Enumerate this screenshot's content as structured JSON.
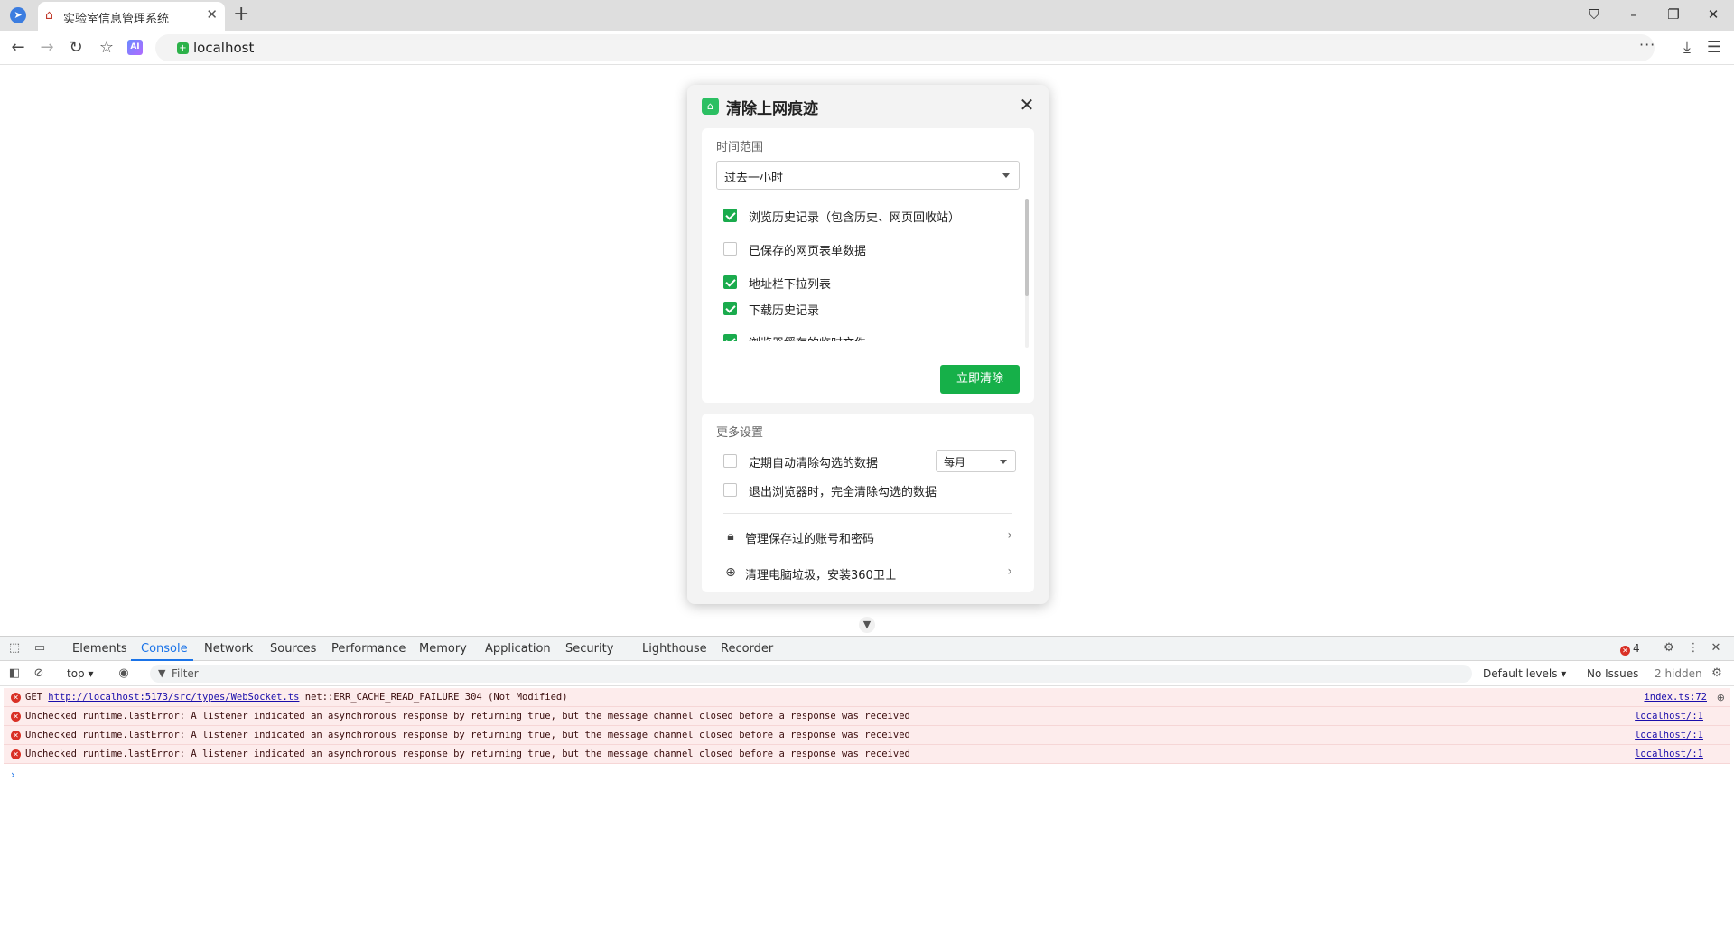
{
  "browser": {
    "tab_title": "实验室信息管理系统",
    "address": "localhost",
    "icons": {
      "browser_logo": "send-arrow-icon",
      "tab_favicon": "house-icon",
      "close": "x-icon",
      "new_tab": "plus-icon",
      "back": "arrow-left-icon",
      "forward": "arrow-right-icon",
      "reload": "reload-icon",
      "favorites": "star-list-icon",
      "ai": "ai-icon",
      "menu": "hamburger-icon",
      "downloads": "download-icon"
    },
    "ai_badge": "AI",
    "more": "···"
  },
  "dialog": {
    "title": "清除上网痕迹",
    "time_range_label": "时间范围",
    "time_range_value": "过去一小时",
    "items": [
      {
        "label": "浏览历史记录（包含历史、网页回收站）",
        "checked": true
      },
      {
        "label": "已保存的网页表单数据",
        "checked": false
      },
      {
        "label": "地址栏下拉列表",
        "checked": true
      },
      {
        "label": "下载历史记录",
        "checked": true
      },
      {
        "label": "浏览器缓存的临时文件",
        "checked": true
      }
    ],
    "clear_button": "立即清除",
    "more_settings_label": "更多设置",
    "auto_clear_label": "定期自动清除勾选的数据",
    "auto_clear_checked": false,
    "period_value": "每月",
    "exit_clear_label": "退出浏览器时，完全清除勾选的数据",
    "exit_clear_checked": false,
    "links": [
      {
        "label": "管理保存过的账号和密码",
        "icon": "lock-icon"
      },
      {
        "label": "清理电脑垃圾，安装360卫士",
        "icon": "shield-plus-icon"
      }
    ],
    "accent_color": "#16b049"
  },
  "devtools": {
    "tabs": [
      "Elements",
      "Console",
      "Network",
      "Sources",
      "Performance",
      "Memory",
      "Application",
      "Security",
      "Lighthouse",
      "Recorder"
    ],
    "active_tab": "Console",
    "error_count": "4",
    "context": "top ▾",
    "filter_placeholder": "Filter",
    "levels": "Default levels ▾",
    "issues": "No Issues",
    "hidden": "2 hidden",
    "logs": [
      {
        "prefix": "GET ",
        "link": "http://localhost:5173/src/types/WebSocket.ts",
        "suffix": " net::ERR_CACHE_READ_FAILURE 304 (Not Modified)",
        "source": "index.ts:72"
      },
      {
        "prefix": "Unchecked runtime.lastError: A listener indicated an asynchronous response by returning true, but the message channel closed before a response was received",
        "link": "",
        "suffix": "",
        "source": "localhost/:1"
      },
      {
        "prefix": "Unchecked runtime.lastError: A listener indicated an asynchronous response by returning true, but the message channel closed before a response was received",
        "link": "",
        "suffix": "",
        "source": "localhost/:1"
      },
      {
        "prefix": "Unchecked runtime.lastError: A listener indicated an asynchronous response by returning true, but the message channel closed before a response was received",
        "link": "",
        "suffix": "",
        "source": "localhost/:1"
      }
    ],
    "prompt": "›",
    "error_color": "#d93025"
  }
}
